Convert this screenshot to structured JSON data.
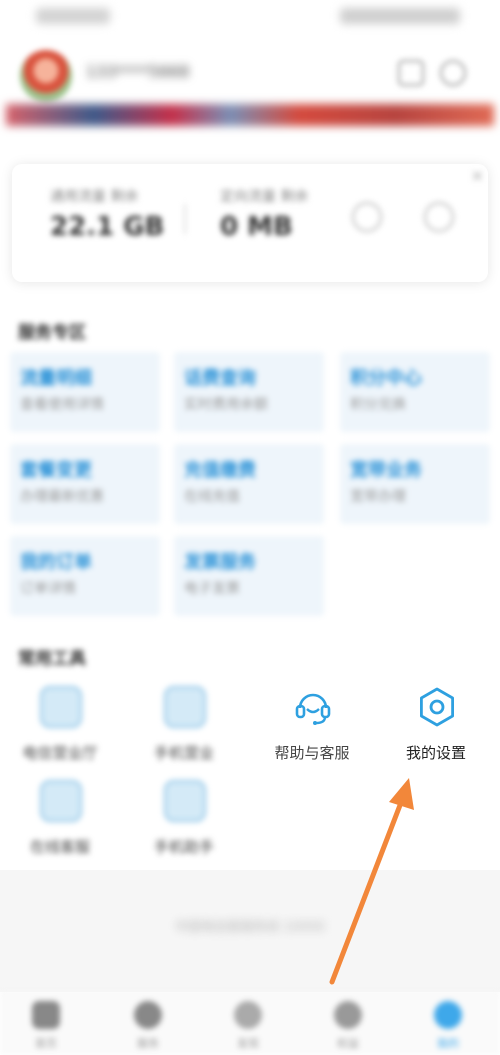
{
  "status_bar": {},
  "header": {
    "account_name": "133****5668"
  },
  "stats": [
    {
      "label": "通用流量 剩余",
      "value": "22.1 GB"
    },
    {
      "label": "定向流量 剩余",
      "value": "0 MB"
    }
  ],
  "services": {
    "title": "服务专区",
    "tiles": [
      {
        "title": "流量明细",
        "sub": "查看使用详情"
      },
      {
        "title": "话费查询",
        "sub": "实时费用余额"
      },
      {
        "title": "积分中心",
        "sub": "积分兑换"
      },
      {
        "title": "套餐变更",
        "sub": "办理最新优惠"
      },
      {
        "title": "充值缴费",
        "sub": "在线充值"
      },
      {
        "title": "宽带业务",
        "sub": "宽带办理"
      },
      {
        "title": "我的订单",
        "sub": "订单详情"
      },
      {
        "title": "发票服务",
        "sub": "电子发票"
      }
    ]
  },
  "tools": {
    "title": "常用工具",
    "items": [
      {
        "label": "电信营业厅"
      },
      {
        "label": "手机营业"
      },
      {
        "label": "帮助与客服"
      },
      {
        "label": "我的设置"
      },
      {
        "label": "在线客服"
      },
      {
        "label": "手机助手"
      }
    ]
  },
  "footer": {
    "note": "中国电信客服热线 10000"
  },
  "tabs": [
    {
      "label": "首页"
    },
    {
      "label": "服务"
    },
    {
      "label": "发现"
    },
    {
      "label": "权益"
    },
    {
      "label": "我的"
    }
  ],
  "colors": {
    "accent": "#2e94d8",
    "arrow": "#f2873a"
  }
}
